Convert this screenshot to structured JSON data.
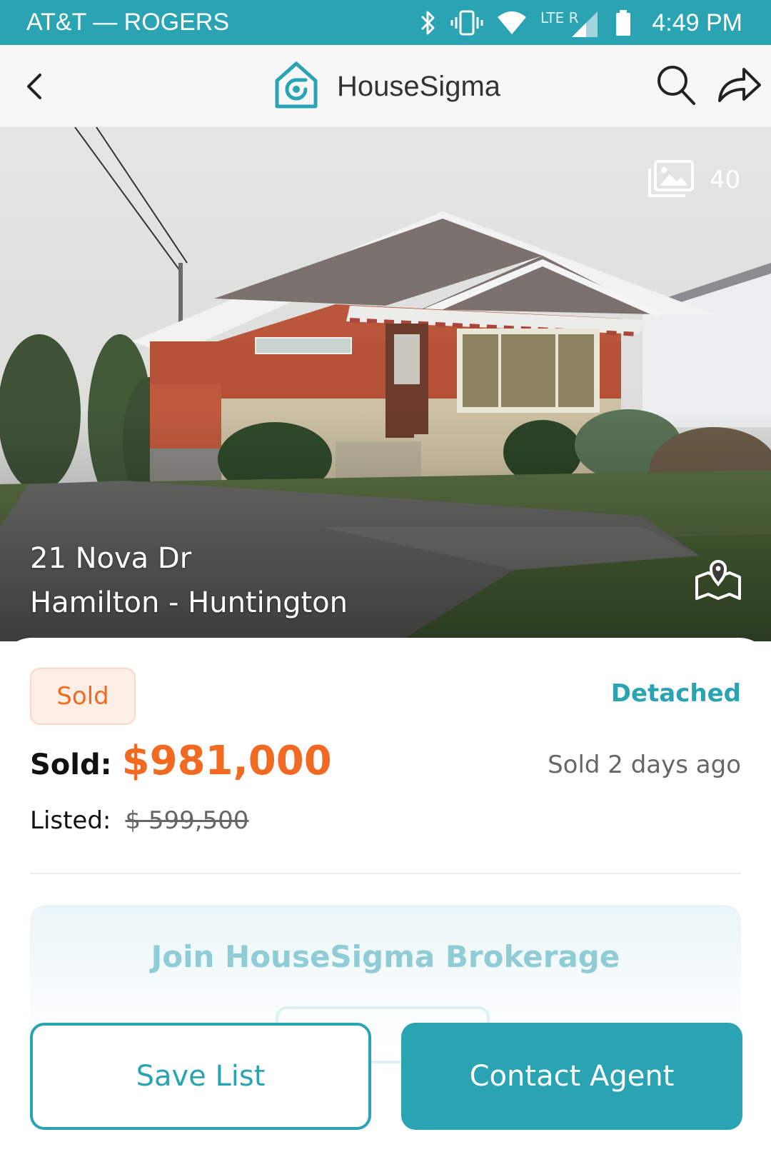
{
  "status_bar": {
    "carrier": "AT&T — ROGERS",
    "network": "LTE R",
    "time": "4:49 PM"
  },
  "header": {
    "app_name": "HouseSigma",
    "back_icon": "chevron-left-icon",
    "search_icon": "search-icon",
    "share_icon": "share-icon"
  },
  "hero": {
    "photo_count": "40",
    "address_line1": "21 Nova Dr",
    "address_line2": "Hamilton - Huntington"
  },
  "listing": {
    "status": "Sold",
    "property_type": "Detached",
    "sold_label": "Sold:",
    "sold_price": "$981,000",
    "sold_ago": "Sold 2 days ago",
    "listed_label": "Listed:",
    "listed_price": "$ 599,500"
  },
  "promo": {
    "title": "Join HouseSigma Brokerage"
  },
  "actions": {
    "save_label": "Save List",
    "contact_label": "Contact Agent"
  },
  "colors": {
    "brand": "#2aa3b3",
    "sold_accent": "#f26a21"
  }
}
